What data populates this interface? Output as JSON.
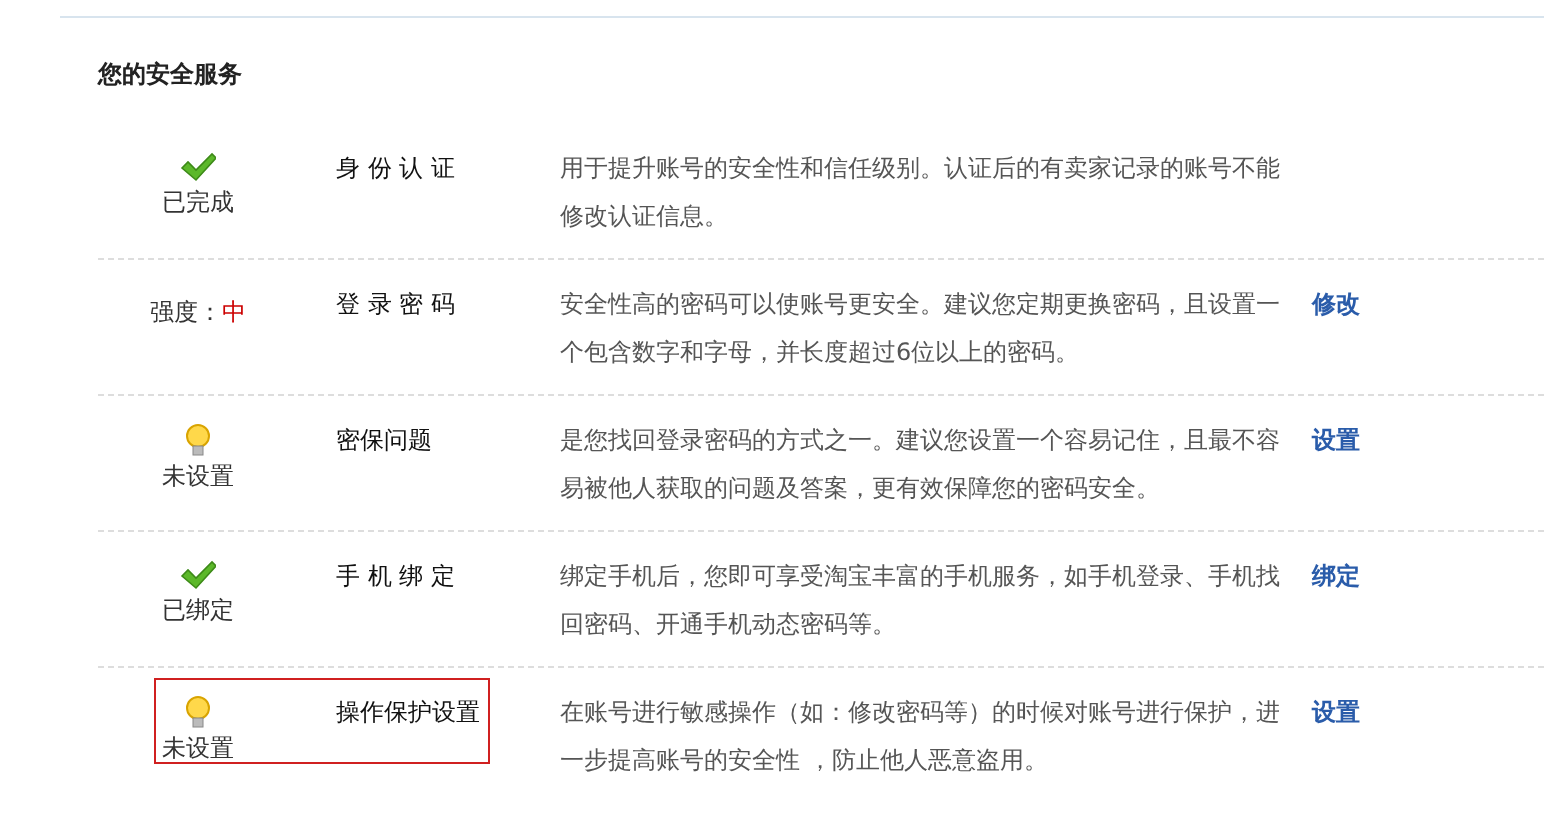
{
  "title": "您的安全服务",
  "services": [
    {
      "status": {
        "kind": "done",
        "label": "已完成"
      },
      "name": "身 份 认 证",
      "description": "用于提升账号的安全性和信任级别。认证后的有卖家记录的账号不能修改认证信息。",
      "highlighted": false
    },
    {
      "status": {
        "kind": "strength",
        "label": "强度：",
        "value": "中"
      },
      "name": "登 录 密 码",
      "description": "安全性高的密码可以使账号更安全。建议您定期更换密码，且设置一个包含数字和字母，并长度超过6位以上的密码。",
      "action": "修改",
      "highlighted": false
    },
    {
      "status": {
        "kind": "unset",
        "label": "未设置"
      },
      "name": "密保问题",
      "description": "是您找回登录密码的方式之一。建议您设置一个容易记住，且最不容易被他人获取的问题及答案，更有效保障您的密码安全。",
      "action": "设置",
      "highlighted": false
    },
    {
      "status": {
        "kind": "done",
        "label": "已绑定"
      },
      "name": "手 机 绑 定",
      "description": "绑定手机后，您即可享受淘宝丰富的手机服务，如手机登录、手机找回密码、开通手机动态密码等。",
      "action": "绑定",
      "highlighted": false
    },
    {
      "status": {
        "kind": "unset",
        "label": "未设置"
      },
      "name": "操作保护设置",
      "description": "在账号进行敏感操作（如：修改密码等）的时候对账号进行保护，进一步提高账号的安全性 ，防止他人恶意盗用。",
      "action": "设置",
      "highlighted": true
    }
  ]
}
